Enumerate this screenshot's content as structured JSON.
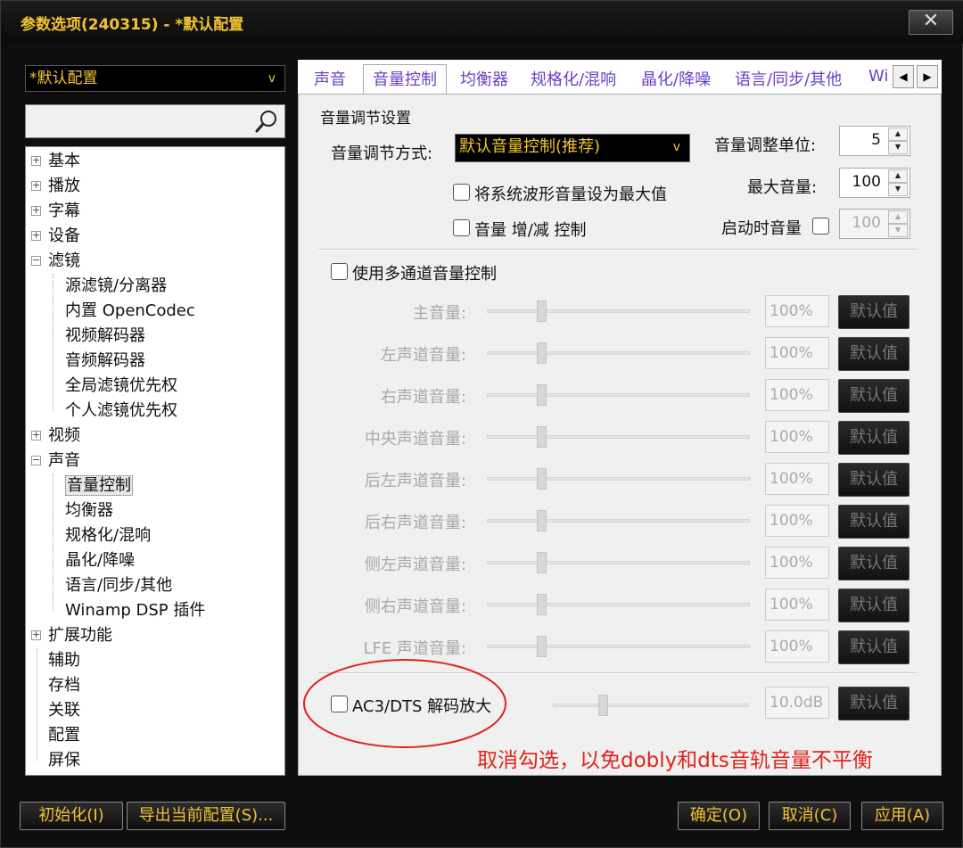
{
  "window": {
    "title": "参数选项(240315) - *默认配置",
    "close_glyph": "✕"
  },
  "left": {
    "preset_value": "*默认配置",
    "preset_arrow": "v",
    "tree": [
      {
        "label": "基本",
        "expander": "+"
      },
      {
        "label": "播放",
        "expander": "+"
      },
      {
        "label": "字幕",
        "expander": "+"
      },
      {
        "label": "设备",
        "expander": "+"
      },
      {
        "label": "滤镜",
        "expander": "−"
      },
      {
        "label": "源滤镜/分离器"
      },
      {
        "label": "内置 OpenCodec"
      },
      {
        "label": "视频解码器"
      },
      {
        "label": "音频解码器"
      },
      {
        "label": "全局滤镜优先权"
      },
      {
        "label": "个人滤镜优先权"
      },
      {
        "label": "视频",
        "expander": "+"
      },
      {
        "label": "声音",
        "expander": "−"
      },
      {
        "label": "音量控制",
        "selected": true
      },
      {
        "label": "均衡器"
      },
      {
        "label": "规格化/混响"
      },
      {
        "label": "晶化/降噪"
      },
      {
        "label": "语言/同步/其他"
      },
      {
        "label": "Winamp DSP 插件"
      },
      {
        "label": "扩展功能",
        "expander": "+"
      },
      {
        "label": "辅助"
      },
      {
        "label": "存档"
      },
      {
        "label": "关联"
      },
      {
        "label": "配置"
      },
      {
        "label": "屏保"
      }
    ]
  },
  "tabs": [
    "声音",
    "音量控制",
    "均衡器",
    "规格化/混响",
    "晶化/降噪",
    "语言/同步/其他",
    "Wi"
  ],
  "tab_scroll": {
    "left": "◀",
    "right": "▶"
  },
  "volume_settings": {
    "section_title": "音量调节设置",
    "method_label": "音量调节方式:",
    "method_value": "默认音量控制(推荐)",
    "method_arrow": "v",
    "step_label": "音量调整单位:",
    "step_value": "5",
    "max_label": "最大音量:",
    "max_value": "100",
    "startup_label": "启动时音量",
    "startup_value": "100",
    "check_waveform_label": "将系统波形音量设为最大值",
    "check_incdec_label": "音量 增/减 控制",
    "spin_up": "▲",
    "spin_down": "▼"
  },
  "multichannel": {
    "label": "使用多通道音量控制",
    "default_label": "默认值",
    "channels": [
      {
        "label": "主音量:",
        "value": "100%"
      },
      {
        "label": "左声道音量:",
        "value": "100%"
      },
      {
        "label": "右声道音量:",
        "value": "100%"
      },
      {
        "label": "中央声道音量:",
        "value": "100%"
      },
      {
        "label": "后左声道音量:",
        "value": "100%"
      },
      {
        "label": "后右声道音量:",
        "value": "100%"
      },
      {
        "label": "侧左声道音量:",
        "value": "100%"
      },
      {
        "label": "侧右声道音量:",
        "value": "100%"
      },
      {
        "label": "LFE 声道音量:",
        "value": "100%"
      }
    ]
  },
  "ac3": {
    "label": "AC3/DTS 解码放大",
    "value": "10.0dB",
    "default_label": "默认值"
  },
  "annotation": "取消勾选，以免dobly和dts音轨音量不平衡",
  "colors": {
    "accent_yellow": "#f2c431",
    "tab_purple": "#6a3fc8",
    "annotation_red": "#e0241b"
  },
  "buttons": {
    "init": "初始化(I)",
    "export": "导出当前配置(S)...",
    "ok": "确定(O)",
    "cancel": "取消(C)",
    "apply": "应用(A)"
  }
}
